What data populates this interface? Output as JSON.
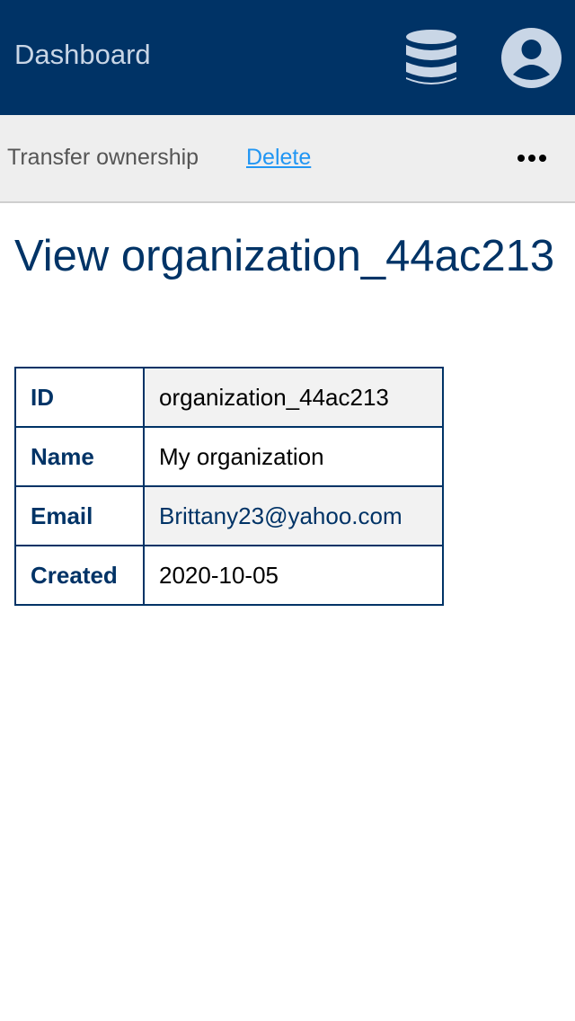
{
  "header": {
    "title": "Dashboard",
    "icons": {
      "database": "database-icon",
      "user": "user-circle-icon"
    },
    "colors": {
      "background": "#003366",
      "title": "#c9d6e6",
      "icon": "#c9d6e6"
    }
  },
  "actions": {
    "transfer_label": "Transfer ownership",
    "delete_label": "Delete",
    "more_icon": "more-horizontal-icon",
    "colors": {
      "link": "#2196f3"
    }
  },
  "page": {
    "title": "View organization_44ac213"
  },
  "details": {
    "rows": [
      {
        "label": "ID",
        "value": "organization_44ac213"
      },
      {
        "label": "Name",
        "value": "My organization"
      },
      {
        "label": "Email",
        "value": "Brittany23@yahoo.com"
      },
      {
        "label": "Created",
        "value": "2020-10-05"
      }
    ]
  }
}
